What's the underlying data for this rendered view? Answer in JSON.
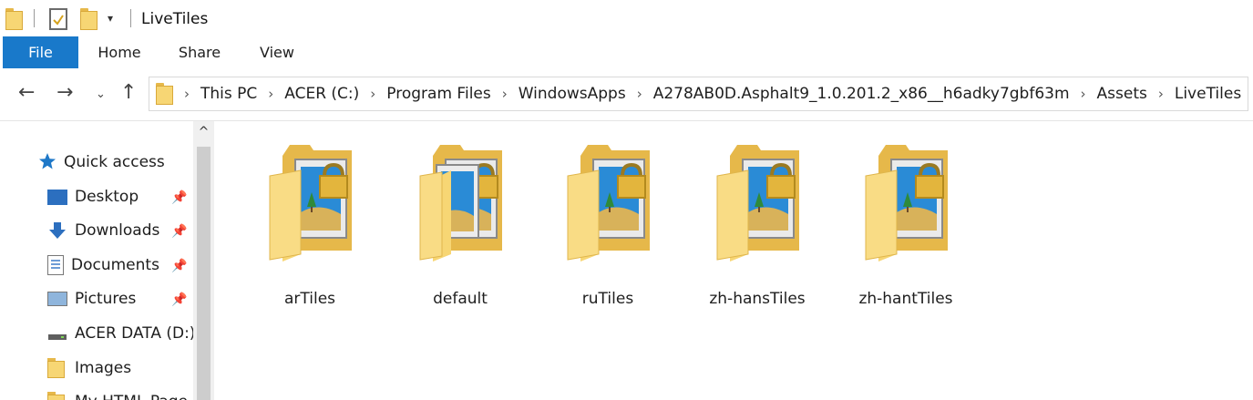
{
  "window": {
    "title": "LiveTiles"
  },
  "ribbon": {
    "tabs": [
      {
        "label": "File",
        "active": true
      },
      {
        "label": "Home"
      },
      {
        "label": "Share"
      },
      {
        "label": "View"
      }
    ],
    "accent_color": "#1979ca"
  },
  "address": {
    "crumbs": [
      "This PC",
      "ACER (C:)",
      "Program Files",
      "WindowsApps",
      "A278AB0D.Asphalt9_1.0.201.2_x86__h6adky7gbf63m",
      "Assets",
      "LiveTiles"
    ]
  },
  "sidebar": {
    "items": [
      {
        "label": "Quick access",
        "icon": "star-icon",
        "pinned": false
      },
      {
        "label": "Desktop",
        "icon": "desktop-icon",
        "pinned": true
      },
      {
        "label": "Downloads",
        "icon": "download-arrow-icon",
        "pinned": true
      },
      {
        "label": "Documents",
        "icon": "documents-icon",
        "pinned": true
      },
      {
        "label": "Pictures",
        "icon": "pictures-icon",
        "pinned": true
      },
      {
        "label": "ACER DATA (D:)",
        "icon": "drive-icon",
        "pinned": false
      },
      {
        "label": "Images",
        "icon": "folder-icon",
        "pinned": false
      },
      {
        "label": "My HTML Page",
        "icon": "folder-icon",
        "pinned": false
      }
    ]
  },
  "folders": [
    {
      "name": "arTiles"
    },
    {
      "name": "default"
    },
    {
      "name": "ruTiles"
    },
    {
      "name": "zh-hansTiles"
    },
    {
      "name": "zh-hantTiles"
    }
  ]
}
